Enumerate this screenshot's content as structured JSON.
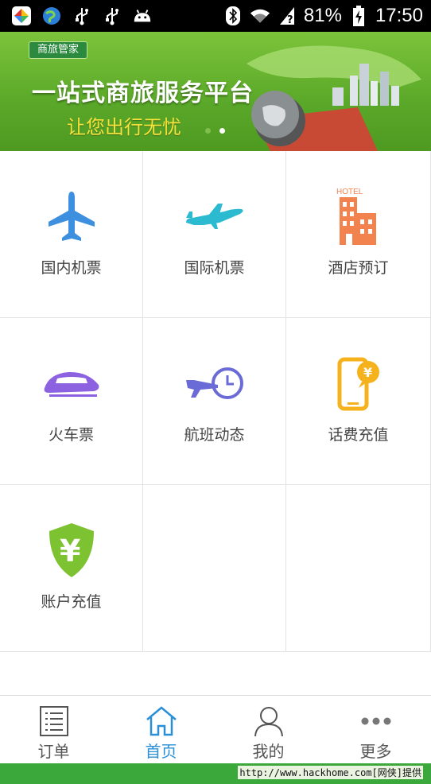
{
  "status_bar": {
    "battery": "81%",
    "time": "17:50",
    "icons": [
      "app-icon",
      "browser-icon",
      "usb-icon",
      "usb-icon",
      "android-icon",
      "bluetooth-icon",
      "wifi-icon",
      "signal-icon",
      "battery-icon"
    ]
  },
  "banner": {
    "logo_text": "商旅管家",
    "title": "一站式商旅服务平台",
    "subtitle": "让您出行无忧",
    "dot_colors": [
      "#7fbf4d",
      "#ffffff"
    ]
  },
  "grid": {
    "items": [
      {
        "label": "国内机票",
        "icon": "airplane-icon",
        "color": "#3d8fe0"
      },
      {
        "label": "国际机票",
        "icon": "jet-icon",
        "color": "#2bbad0"
      },
      {
        "label": "酒店预订",
        "icon": "hotel-icon",
        "color": "#f2834f",
        "icon_text": "HOTEL"
      },
      {
        "label": "火车票",
        "icon": "train-icon",
        "color": "#8d62e0"
      },
      {
        "label": "航班动态",
        "icon": "flight-status-icon",
        "color": "#6b6bd8"
      },
      {
        "label": "话费充值",
        "icon": "phone-recharge-icon",
        "color": "#f5b21d",
        "icon_text": "¥"
      },
      {
        "label": "账户充值",
        "icon": "yuan-shield-icon",
        "color": "#7dc230",
        "icon_text": "¥"
      }
    ]
  },
  "tabbar": {
    "tabs": [
      {
        "label": "订单",
        "icon": "order-list-icon"
      },
      {
        "label": "首页",
        "icon": "home-icon",
        "active": true
      },
      {
        "label": "我的",
        "icon": "user-icon"
      },
      {
        "label": "更多",
        "icon": "more-icon"
      }
    ],
    "active_color": "#2a8fd6",
    "inactive_color": "#555555"
  },
  "footer": {
    "watermark": "http://www.hackhome.com[网侠]提供"
  }
}
